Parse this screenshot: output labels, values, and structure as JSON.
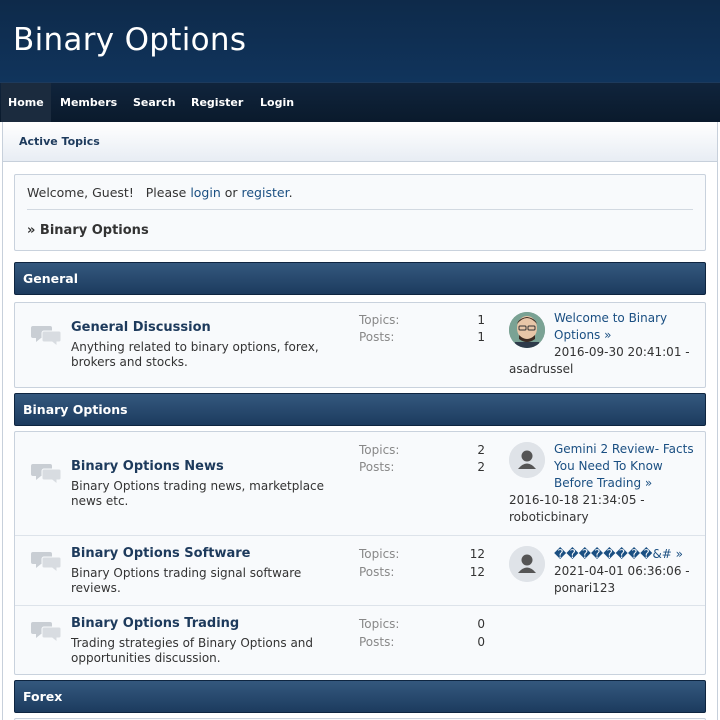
{
  "site": {
    "title": "Binary Options"
  },
  "menu": {
    "items": [
      "Home",
      "Members",
      "Search",
      "Register",
      "Login"
    ]
  },
  "subbar": {
    "active_topics": "Active Topics"
  },
  "welcome": {
    "prefix": "Welcome, Guest!   Please ",
    "login": "login",
    "or": " or ",
    "register": "register",
    "suffix": ".",
    "breadcrumb": "» Binary Options"
  },
  "categories": [
    {
      "name": "General",
      "forums": [
        {
          "title": "General Discussion",
          "description": "Anything related to binary options, forex, brokers and stocks.",
          "topics_label": "Topics:",
          "topics": "1",
          "posts_label": "Posts:",
          "posts": "1",
          "last_post": {
            "title": "Welcome to Binary Options »",
            "date": "2016-09-30 20:41:01 -",
            "author": "asadrussel",
            "avatar": "cartoon-man-avatar"
          }
        }
      ]
    },
    {
      "name": "Binary Options",
      "forums": [
        {
          "title": "Binary Options News",
          "description": "Binary Options trading news, marketplace news etc.",
          "topics_label": "Topics:",
          "topics": "2",
          "posts_label": "Posts:",
          "posts": "2",
          "last_post": {
            "title": "Gemini 2 Review- Facts You Need To Know Before Trading »",
            "date": "2016-10-18 21:34:05 -",
            "author": "roboticbinary",
            "avatar": "default-user-avatar"
          }
        },
        {
          "title": "Binary Options Software",
          "description": "Binary Options trading signal software reviews.",
          "topics_label": "Topics:",
          "topics": "12",
          "posts_label": "Posts:",
          "posts": "12",
          "last_post": {
            "title": "��������&# »",
            "date": "2021-04-01 06:36:06 -",
            "author": "ponari123",
            "avatar": "default-user-avatar"
          }
        },
        {
          "title": "Binary Options Trading",
          "description": "Trading strategies of Binary Options and opportunities discussion.",
          "topics_label": "Topics:",
          "topics": "0",
          "posts_label": "Posts:",
          "posts": "0"
        }
      ]
    },
    {
      "name": "Forex",
      "forums": []
    }
  ],
  "colors": {
    "header_bg": "#0e2a4a",
    "cat_header": "#1c3b5e",
    "link": "#1a4f82",
    "title": "#1d3a5c"
  },
  "icons": {
    "forum": "chat-bubbles-icon"
  }
}
